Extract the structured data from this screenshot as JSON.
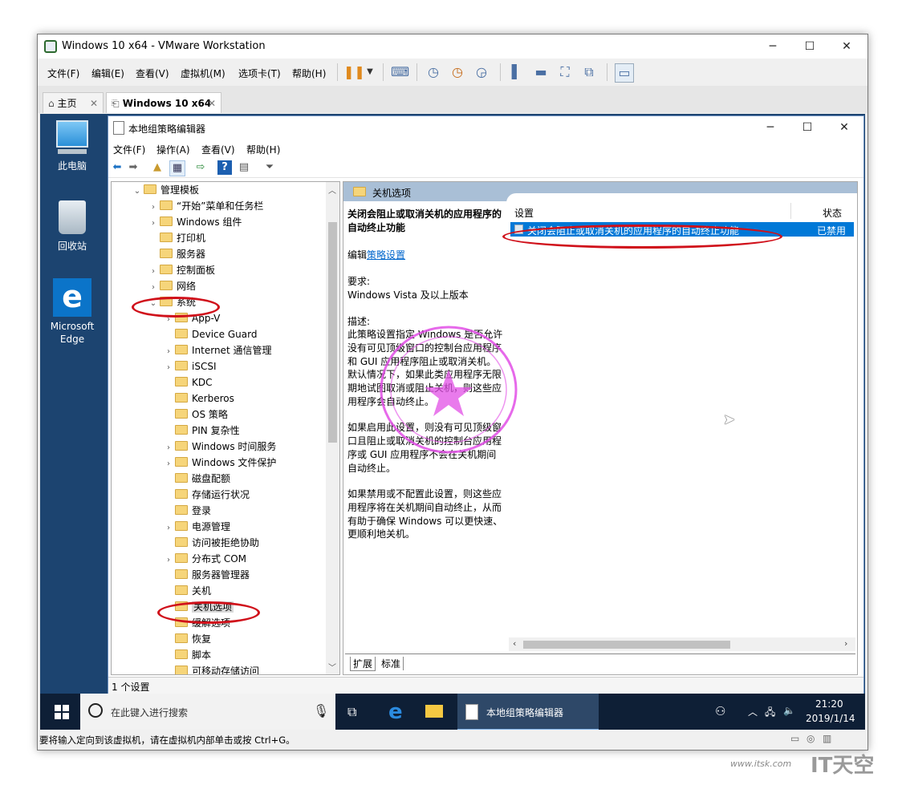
{
  "vmware": {
    "title": "Windows 10 x64 - VMware Workstation",
    "menu": [
      "文件(F)",
      "编辑(E)",
      "查看(V)",
      "虚拟机(M)",
      "选项卡(T)",
      "帮助(H)"
    ],
    "tabs": [
      {
        "label": "主页"
      },
      {
        "label": "Windows 10 x64"
      }
    ],
    "status_message": "要将输入定向到该虚拟机，请在虚拟机内部单击或按 Ctrl+G。"
  },
  "desktop": {
    "icons": [
      "此电脑",
      "回收站",
      "Microsoft Edge"
    ]
  },
  "gpedit": {
    "title": "本地组策略编辑器",
    "menu": [
      "文件(F)",
      "操作(A)",
      "查看(V)",
      "帮助(H)"
    ],
    "tree": [
      {
        "label": "管理模板",
        "arrow": "⌄",
        "level": 0
      },
      {
        "label": "“开始”菜单和任务栏",
        "arrow": "›",
        "level": 1
      },
      {
        "label": "Windows 组件",
        "arrow": "›",
        "level": 1
      },
      {
        "label": "打印机",
        "arrow": "",
        "level": 1
      },
      {
        "label": "服务器",
        "arrow": "",
        "level": 1
      },
      {
        "label": "控制面板",
        "arrow": "›",
        "level": 1
      },
      {
        "label": "网络",
        "arrow": "›",
        "level": 1
      },
      {
        "label": "系统",
        "arrow": "⌄",
        "level": 1
      },
      {
        "label": "App-V",
        "arrow": "›",
        "level": 2
      },
      {
        "label": "Device Guard",
        "arrow": "",
        "level": 2
      },
      {
        "label": "Internet 通信管理",
        "arrow": "›",
        "level": 2
      },
      {
        "label": "iSCSI",
        "arrow": "›",
        "level": 2
      },
      {
        "label": "KDC",
        "arrow": "",
        "level": 2
      },
      {
        "label": "Kerberos",
        "arrow": "",
        "level": 2
      },
      {
        "label": "OS 策略",
        "arrow": "",
        "level": 2
      },
      {
        "label": "PIN 复杂性",
        "arrow": "",
        "level": 2
      },
      {
        "label": "Windows 时间服务",
        "arrow": "›",
        "level": 2
      },
      {
        "label": "Windows 文件保护",
        "arrow": "›",
        "level": 2
      },
      {
        "label": "磁盘配额",
        "arrow": "",
        "level": 2
      },
      {
        "label": "存储运行状况",
        "arrow": "",
        "level": 2
      },
      {
        "label": "登录",
        "arrow": "",
        "level": 2
      },
      {
        "label": "电源管理",
        "arrow": "›",
        "level": 2
      },
      {
        "label": "访问被拒绝协助",
        "arrow": "",
        "level": 2
      },
      {
        "label": "分布式 COM",
        "arrow": "›",
        "level": 2
      },
      {
        "label": "服务器管理器",
        "arrow": "",
        "level": 2
      },
      {
        "label": "关机",
        "arrow": "",
        "level": 2
      },
      {
        "label": "关机选项",
        "arrow": "",
        "level": 2,
        "selected": true
      },
      {
        "label": "缓解选项",
        "arrow": "",
        "level": 2
      },
      {
        "label": "恢复",
        "arrow": "",
        "level": 2
      },
      {
        "label": "脚本",
        "arrow": "",
        "level": 2
      },
      {
        "label": "可移动存储访问",
        "arrow": "",
        "level": 2
      }
    ],
    "right_header": "关机选项",
    "desc": {
      "title": "关闭会阻止或取消关机的应用程序的自动终止功能",
      "edit_prefix": "编辑",
      "edit_link": "策略设置",
      "req_label": "要求:",
      "req_value": "Windows Vista 及以上版本",
      "desc_label": "描述:",
      "p1": "此策略设置指定 Windows 是否允许没有可见顶级窗口的控制台应用程序和 GUI 应用程序阻止或取消关机。默认情况下，如果此类应用程序无限期地试图取消或阻止关机，则这些应用程序会自动终止。",
      "p2": "如果启用此设置，则没有可见顶级窗口且阻止或取消关机的控制台应用程序或 GUI 应用程序不会在关机期间自动终止。",
      "p3": "如果禁用或不配置此设置，则这些应用程序将在关机期间自动终止，从而有助于确保 Windows 可以更快速、更顺利地关机。"
    },
    "list_headers": {
      "setting": "设置",
      "state": "状态"
    },
    "list_rows": [
      {
        "setting": "关闭会阻止或取消关机的应用程序的自动终止功能",
        "state": "已禁用"
      }
    ],
    "bottom_tabs": [
      "扩展",
      "标准"
    ],
    "status": "1 个设置"
  },
  "taskbar": {
    "search_placeholder": "在此键入进行搜索",
    "active_app": "本地组策略编辑器",
    "time": "21:20",
    "date": "2019/1/14"
  },
  "watermark": "www.itsk.com",
  "watermark_brand": "IT天空",
  "colors": {
    "accent": "#0078d7",
    "highlight": "#d0101a",
    "taskbar": "#0e1f36"
  }
}
